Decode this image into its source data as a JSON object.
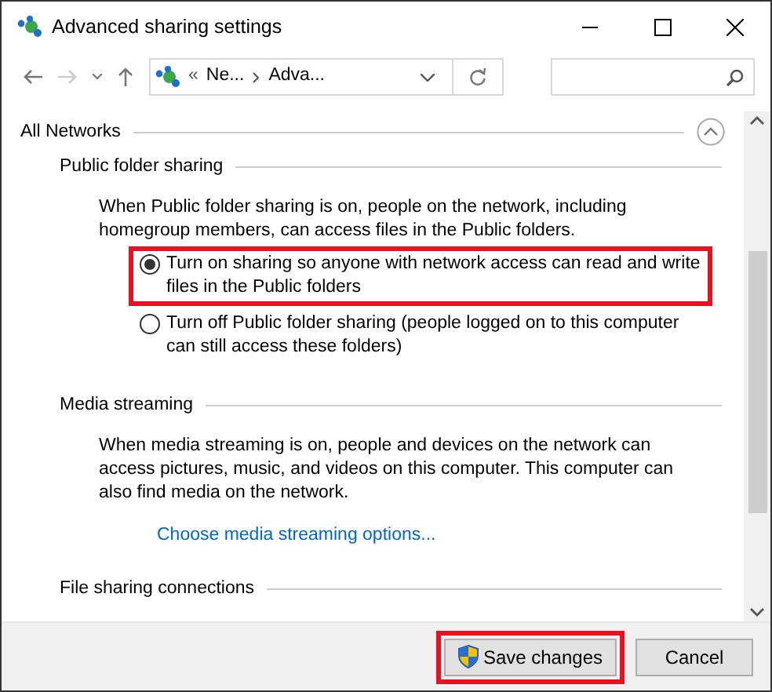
{
  "window": {
    "title": "Advanced sharing settings"
  },
  "address_bar": {
    "overflow": "«",
    "segments": [
      "Ne...",
      "Adva..."
    ]
  },
  "section": {
    "title": "All Networks",
    "expanded": true,
    "groups": [
      {
        "title": "Public folder sharing",
        "description": "When Public folder sharing is on, people on the network, including homegroup members, can access files in the Public folders.",
        "options": [
          {
            "label": "Turn on sharing so anyone with network access can read and write files in the Public folders",
            "selected": true,
            "highlighted": true
          },
          {
            "label": "Turn off Public folder sharing (people logged on to this computer can still access these folders)",
            "selected": false,
            "highlighted": false
          }
        ]
      },
      {
        "title": "Media streaming",
        "description": "When media streaming is on, people and devices on the network can access pictures, music, and videos on this computer. This computer can also find media on the network.",
        "link": "Choose media streaming options..."
      },
      {
        "title": "File sharing connections"
      }
    ]
  },
  "buttons": [
    {
      "label": "Save changes",
      "kind": "shield",
      "highlighted": true
    },
    {
      "label": "Cancel",
      "kind": "plain",
      "highlighted": false
    }
  ]
}
